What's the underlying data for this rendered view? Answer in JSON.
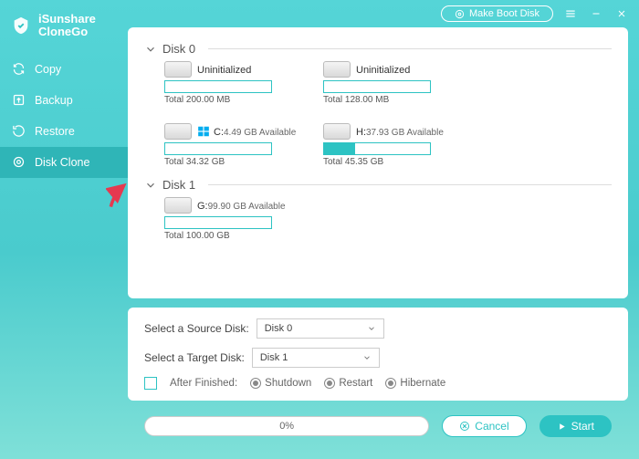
{
  "brand": {
    "line1": "iSunshare",
    "line2": "CloneGo"
  },
  "titlebar": {
    "make_boot_disk": "Make Boot Disk"
  },
  "nav": {
    "copy": "Copy",
    "backup": "Backup",
    "restore": "Restore",
    "disk_clone": "Disk Clone"
  },
  "disks": [
    {
      "name": "Disk 0",
      "parts": [
        {
          "label": "Uninitialized",
          "avail": "",
          "total": "Total 200.00 MB",
          "fill": 0,
          "win": false
        },
        {
          "label": "Uninitialized",
          "avail": "",
          "total": "Total 128.00 MB",
          "fill": 0,
          "win": false
        },
        {
          "label": "C:",
          "avail": "4.49 GB Available",
          "total": "Total 34.32 GB",
          "fill": 0,
          "win": true
        },
        {
          "label": "H:",
          "avail": "37.93 GB Available",
          "total": "Total 45.35 GB",
          "fill": 29,
          "win": false
        }
      ]
    },
    {
      "name": "Disk 1",
      "parts": [
        {
          "label": "G:",
          "avail": "99.90 GB Available",
          "total": "Total 100.00 GB",
          "fill": 0,
          "win": false
        }
      ]
    }
  ],
  "select": {
    "source_label": "Select a Source Disk:",
    "target_label": "Select a Target Disk:",
    "source_value": "Disk 0",
    "target_value": "Disk 1"
  },
  "after": {
    "label": "After Finished:",
    "shutdown": "Shutdown",
    "restart": "Restart",
    "hibernate": "Hibernate"
  },
  "progress": {
    "text": "0%"
  },
  "buttons": {
    "cancel": "Cancel",
    "start": "Start"
  }
}
